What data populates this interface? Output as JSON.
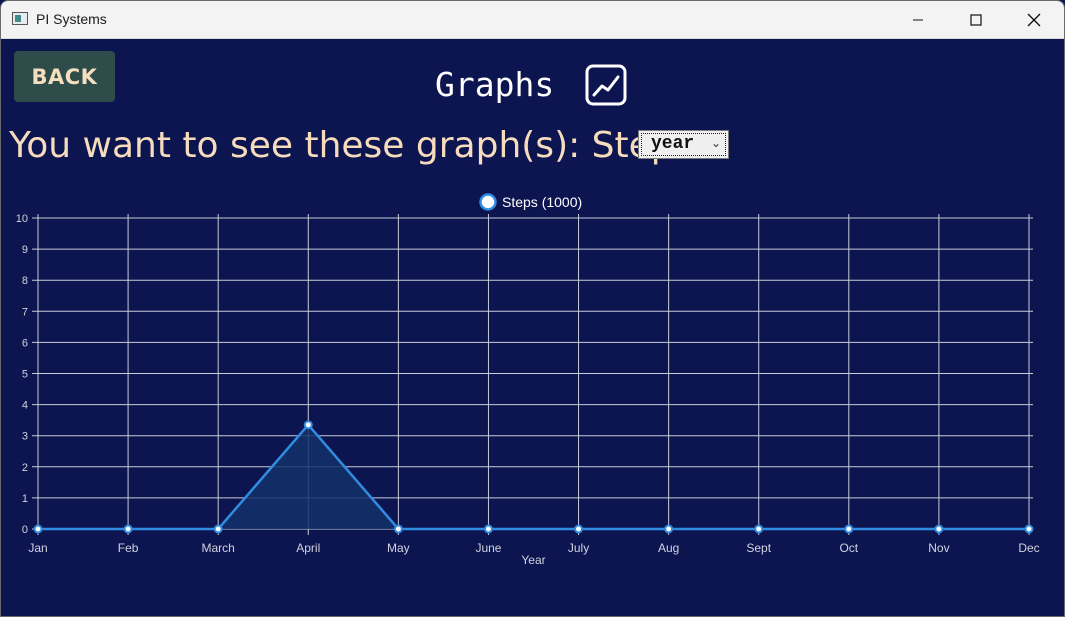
{
  "window": {
    "title": "PI Systems"
  },
  "header": {
    "back_label": "BACK",
    "title": "Graphs"
  },
  "prompt": {
    "text": "You want to see these graph(s): Steps"
  },
  "range_select": {
    "value": "year"
  },
  "colors": {
    "background": "#0c1550",
    "line": "#2f8ce0",
    "fill": "#14306a",
    "grid": "#c9ccd8",
    "accent_text": "#f6dcbc"
  },
  "chart_data": {
    "type": "line",
    "categories": [
      "Jan",
      "Feb",
      "March",
      "April",
      "May",
      "June",
      "July",
      "Aug",
      "Sept",
      "Oct",
      "Nov",
      "Dec"
    ],
    "series": [
      {
        "name": "Steps (1000)",
        "values": [
          0,
          0,
          0,
          3.35,
          0,
          0,
          0,
          0,
          0,
          0,
          0,
          0
        ]
      }
    ],
    "xlabel": "Year",
    "ylabel": "",
    "ylim": [
      0,
      10
    ],
    "yticks": [
      0,
      1,
      2,
      3,
      4,
      5,
      6,
      7,
      8,
      9,
      10
    ],
    "grid": true,
    "legend": "top-center"
  }
}
